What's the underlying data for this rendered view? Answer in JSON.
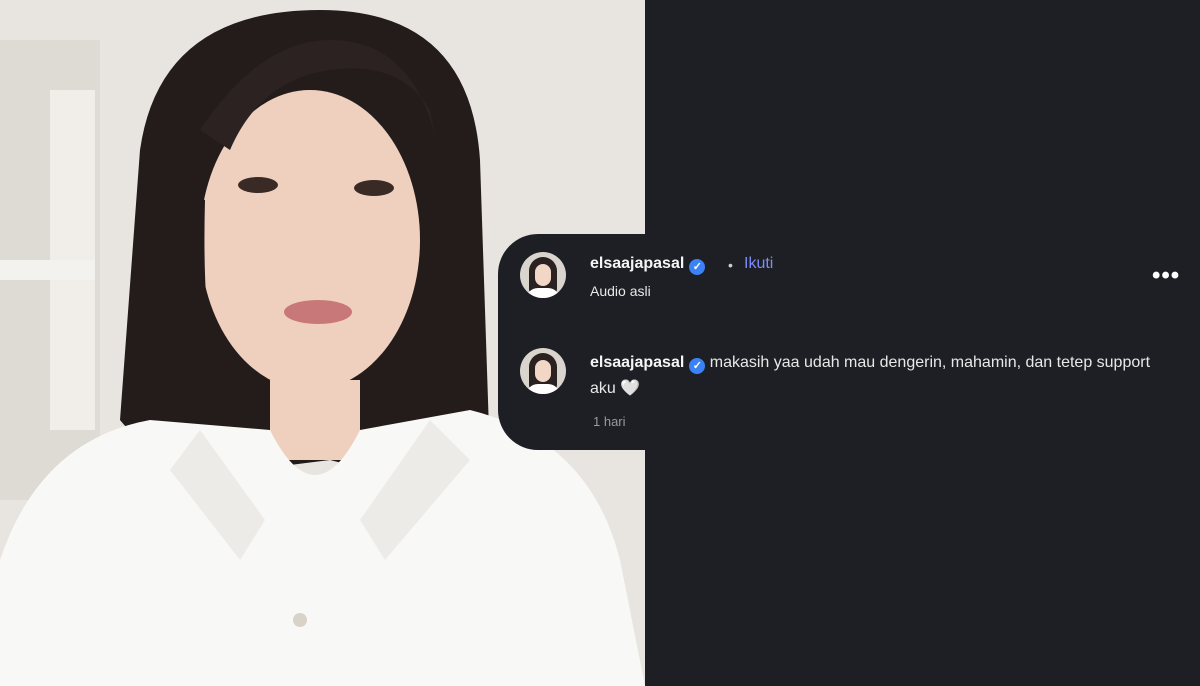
{
  "post": {
    "username": "elsaajapasal",
    "follow_label": "Ikuti",
    "audio_label": "Audio asli",
    "more_label": "•••"
  },
  "comment": {
    "username": "elsaajapasal",
    "text": "makasih yaa udah mau dengerin, mahamin, dan tetep support aku",
    "emoji": "🤍",
    "time": "1 hari"
  },
  "icons": [
    "verified-badge-icon",
    "more-options-icon",
    "heart-emoji"
  ],
  "colors": {
    "background": "#1e1f24",
    "accent_link": "#7c8cf8",
    "verified": "#3b82f6"
  }
}
